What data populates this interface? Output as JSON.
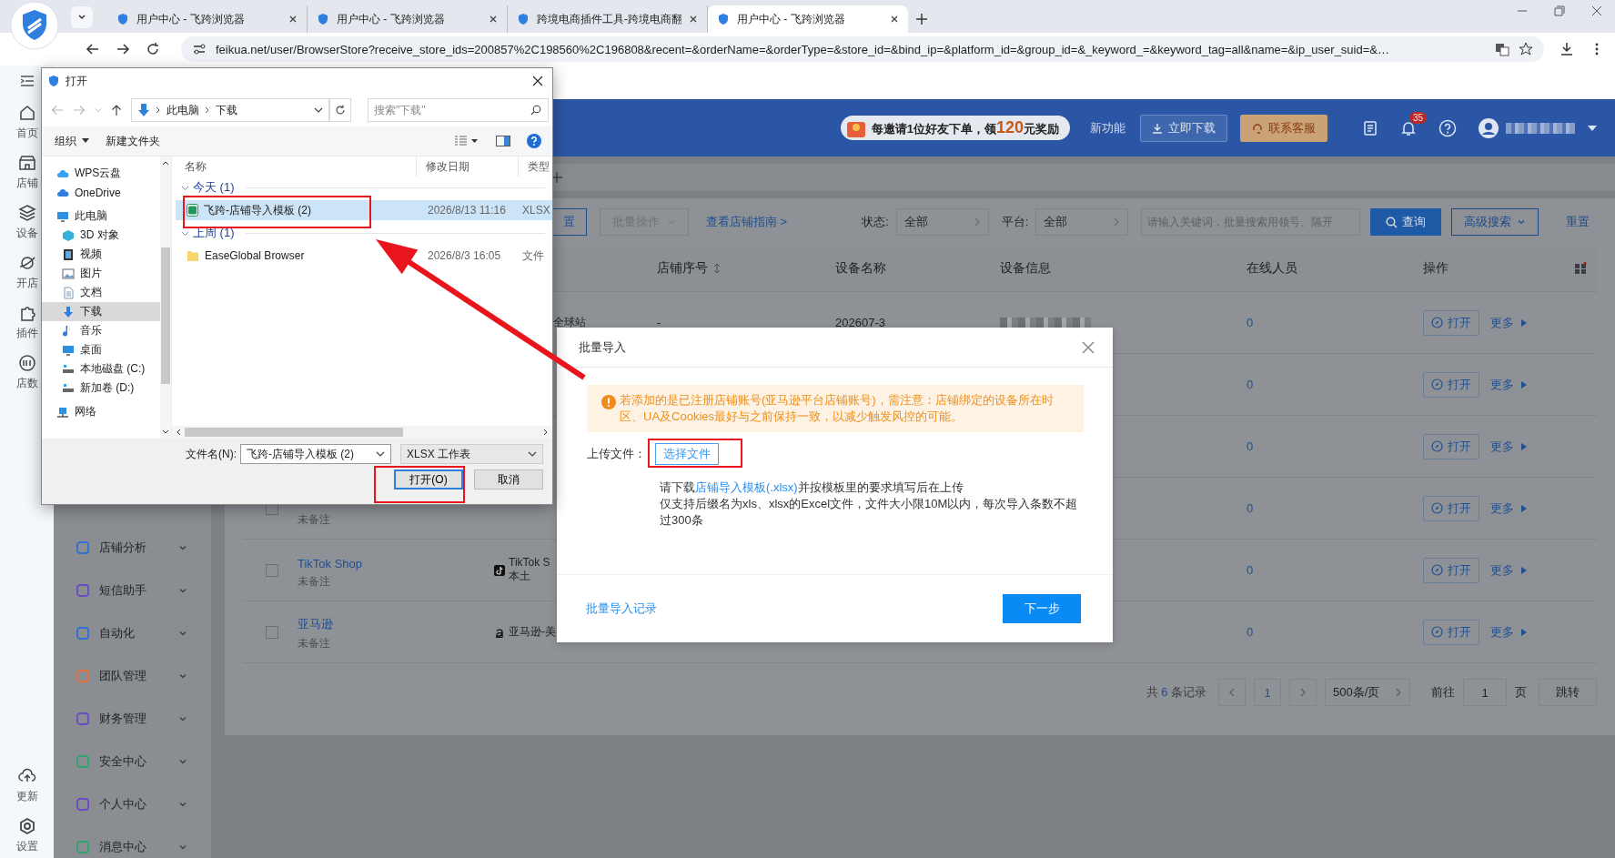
{
  "browser": {
    "tabs": [
      {
        "title": "用户中心 - 飞跨浏览器",
        "selected": false
      },
      {
        "title": "用户中心 - 飞跨浏览器",
        "selected": false
      },
      {
        "title": "跨境电商插件工具-跨境电商翻",
        "selected": false
      },
      {
        "title": "用户中心 - 飞跨浏览器",
        "selected": true
      }
    ],
    "url": "feikua.net/user/BrowserStore?receive_store_ids=200857%2C198560%2C196808&recent=&orderName=&orderType=&store_id=&bind_ip=&platform_id=&group_id=&_keyword_=&keyword_tag=all&name=&ip_user_suid=&…"
  },
  "rail": {
    "items": [
      "首页",
      "店铺",
      "设备",
      "开店",
      "插件",
      "店数"
    ],
    "bottom": [
      "更新",
      "设置"
    ]
  },
  "header": {
    "promo": {
      "before": "每邀请1位好友下单，领",
      "amount": "120",
      "after": "元奖励"
    },
    "new_feature": "新功能",
    "download_button": "立即下载",
    "support_button": "联系客服",
    "notification_count": "35"
  },
  "sidebar": {
    "items": [
      {
        "label": "店铺分析",
        "color": "#2f6fd6"
      },
      {
        "label": "短信助手",
        "color": "#6a4bc4"
      },
      {
        "label": "自动化",
        "color": "#2f6fd6"
      },
      {
        "label": "团队管理",
        "color": "#e0763a"
      },
      {
        "label": "财务管理",
        "color": "#6a4bc4"
      },
      {
        "label": "安全中心",
        "color": "#2ea36b"
      },
      {
        "label": "个人中心",
        "color": "#6a4bc4"
      },
      {
        "label": "消息中心",
        "color": "#2ea36b"
      }
    ]
  },
  "toolbar": {
    "settings_button": "置",
    "batch_button": {
      "label": "批量操作",
      "disabled": true
    },
    "guide_link": "查看店铺指南 >",
    "status": {
      "label": "状态:",
      "value": "全部"
    },
    "platform": {
      "label": "平台:",
      "value": "全部"
    },
    "search_placeholder": "请输入关键词，批量搜索用领号、隔开",
    "query_button": "查询",
    "advanced_button": "高级搜索",
    "reset_link": "重置"
  },
  "table": {
    "columns": [
      "店铺序号",
      "设备名称",
      "设备信息",
      "在线人员",
      "操作"
    ],
    "rows": [
      {
        "kind": "plain",
        "platform": "全球站",
        "serial": "-",
        "device": "202607-3",
        "online": "0",
        "open_button": "打开",
        "more_link": "更多"
      },
      {
        "kind": "plain",
        "online": "0",
        "open_button": "打开",
        "more_link": "更多"
      },
      {
        "kind": "plain",
        "online": "0",
        "open_button": "打开",
        "more_link": "更多"
      },
      {
        "kind": "plain",
        "checked": false,
        "note": "未备注",
        "online": "0",
        "open_button": "打开",
        "more_link": "更多"
      },
      {
        "kind": "tiktok",
        "checked": false,
        "name": "TikTok Shop",
        "note": "未备注",
        "platform": "TikTok S",
        "platform_line2": "本土",
        "online": "0",
        "open_button": "打开",
        "more_link": "更多"
      },
      {
        "kind": "amazon",
        "checked": false,
        "name": "亚马逊",
        "note": "未备注",
        "platform": "亚马逊-美",
        "online": "0",
        "open_button": "打开",
        "more_link": "更多"
      }
    ]
  },
  "pagination": {
    "total": {
      "before": "共",
      "count": "6",
      "after": "条记录"
    },
    "pages": [
      {
        "label": "1",
        "selected": true
      }
    ],
    "page_size": "500条/页",
    "goto_label": "前往",
    "goto_value": "1",
    "page_unit": "页",
    "jump_button": "跳转"
  },
  "import_modal": {
    "title": "批量导入",
    "warning": "若添加的是已注册店铺账号(亚马逊平台店铺账号)，需注意：店铺绑定的设备所在时区、UA及Cookies最好与之前保持一致，以减少触发风控的可能。",
    "upload_label": "上传文件：",
    "choose_button": "选择文件",
    "hint_before": "请下载",
    "template_link": "店铺导入模板(.xlsx)",
    "hint_after": "并按模板里的要求填写后在上传",
    "limits": "仅支持后缀名为xls、xlsx的Excel文件，文件大小限10M以内，每次导入条数不超过300条",
    "history_link": "批量导入记录",
    "next_button": "下一步"
  },
  "file_dialog": {
    "title": "打开",
    "path": [
      "此电脑",
      "下载"
    ],
    "search_placeholder": "搜索\"下载\"",
    "organize": "组织",
    "new_folder": "新建文件夹",
    "tree": [
      {
        "label": "WPS云盘",
        "selected": false
      },
      {
        "label": "OneDrive",
        "selected": false
      },
      {
        "label": "此电脑",
        "selected": false,
        "children": [
          {
            "label": "3D 对象",
            "selected": false
          },
          {
            "label": "视频",
            "selected": false
          },
          {
            "label": "图片",
            "selected": false
          },
          {
            "label": "文档",
            "selected": false
          },
          {
            "label": "下载",
            "selected": true
          },
          {
            "label": "音乐",
            "selected": false
          },
          {
            "label": "桌面",
            "selected": false
          },
          {
            "label": "本地磁盘 (C:)",
            "selected": false
          },
          {
            "label": "新加卷 (D:)",
            "selected": false
          }
        ]
      },
      {
        "label": "网络",
        "selected": false
      }
    ],
    "columns": [
      "名称",
      "修改日期",
      "类型"
    ],
    "groups": [
      {
        "label": "今天 (1)",
        "expanded": true,
        "files": [
          {
            "kind": "spreadsheet",
            "name": "飞跨-店铺导入模板 (2)",
            "date": "2026/8/13 11:16",
            "type": "XLSX",
            "selected": true
          }
        ]
      },
      {
        "label": "上周 (1)",
        "expanded": true,
        "files": [
          {
            "kind": "folder",
            "name": "EaseGlobal Browser",
            "date": "2026/8/3 16:05",
            "type": "文件",
            "selected": false
          }
        ]
      }
    ],
    "filename_label": "文件名(N):",
    "filename": "飞跨-店铺导入模板 (2)",
    "filetype": "XLSX 工作表",
    "open_button": "打开(O)",
    "cancel_button": "取消"
  }
}
